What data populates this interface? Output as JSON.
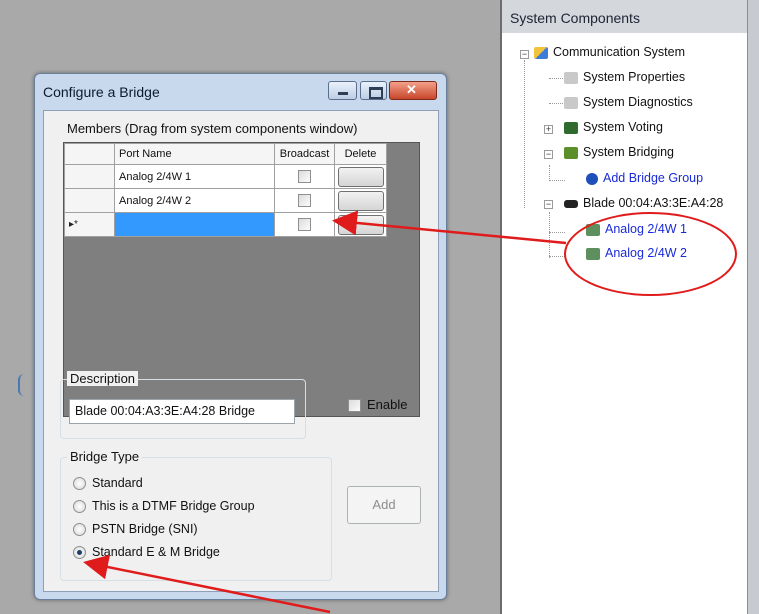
{
  "dialog": {
    "title": "Configure a Bridge",
    "members_label": "Members (Drag from system components window)",
    "columns": [
      "Port Name",
      "Broadcast",
      "Delete"
    ],
    "rows": [
      {
        "marker": "",
        "port": "Analog 2/4W 1",
        "broadcast": false
      },
      {
        "marker": "",
        "port": "Analog 2/4W 2",
        "broadcast": false
      },
      {
        "marker": "▸*",
        "port": "",
        "broadcast": false
      }
    ],
    "description_label": "Description",
    "description_value": "Blade 00:04:A3:3E:A4:28 Bridge",
    "enable_label": "Enable",
    "bridge_type_label": "Bridge Type",
    "bridge_types": [
      "Standard",
      "This is a DTMF Bridge Group",
      "PSTN Bridge (SNI)",
      "Standard E & M Bridge"
    ],
    "selected_bridge_type": "Standard E & M Bridge",
    "add_label": "Add"
  },
  "panel": {
    "title": "System Components",
    "tree": [
      {
        "label": "Communication System",
        "icon": "network-icon"
      },
      {
        "label": "System Properties",
        "icon": "properties-icon"
      },
      {
        "label": "System Diagnostics",
        "icon": "diagnostics-icon"
      },
      {
        "label": "System Voting",
        "icon": "voting-icon"
      },
      {
        "label": "System Bridging",
        "icon": "bridging-icon"
      },
      {
        "label": "Add Bridge Group",
        "icon": "add-icon"
      },
      {
        "label": "Blade 00:04:A3:3E:A4:28",
        "icon": "blade-icon"
      },
      {
        "label": "Analog 2/4W 1",
        "icon": "port-icon"
      },
      {
        "label": "Analog 2/4W 2",
        "icon": "port-icon"
      }
    ]
  },
  "colors": {
    "annotation_red": "#e01b1b",
    "selection_blue": "#3399ff",
    "tree_link_blue": "#1a2ad6"
  }
}
